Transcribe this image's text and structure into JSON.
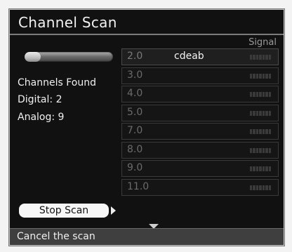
{
  "title": "Channel Scan",
  "signal_header": "Signal",
  "progress": 0.18,
  "info": {
    "channels_found": "Channels Found",
    "digital": "Digital: 2",
    "analog": "Analog: 9"
  },
  "channels": [
    {
      "number": "2.0",
      "name": "cdeab"
    },
    {
      "number": "3.0",
      "name": ""
    },
    {
      "number": "4.0",
      "name": ""
    },
    {
      "number": "5.0",
      "name": ""
    },
    {
      "number": "7.0",
      "name": ""
    },
    {
      "number": "8.0",
      "name": ""
    },
    {
      "number": "9.0",
      "name": ""
    },
    {
      "number": "11.0",
      "name": ""
    }
  ],
  "stop_button": "Stop Scan",
  "status": "Cancel the scan"
}
